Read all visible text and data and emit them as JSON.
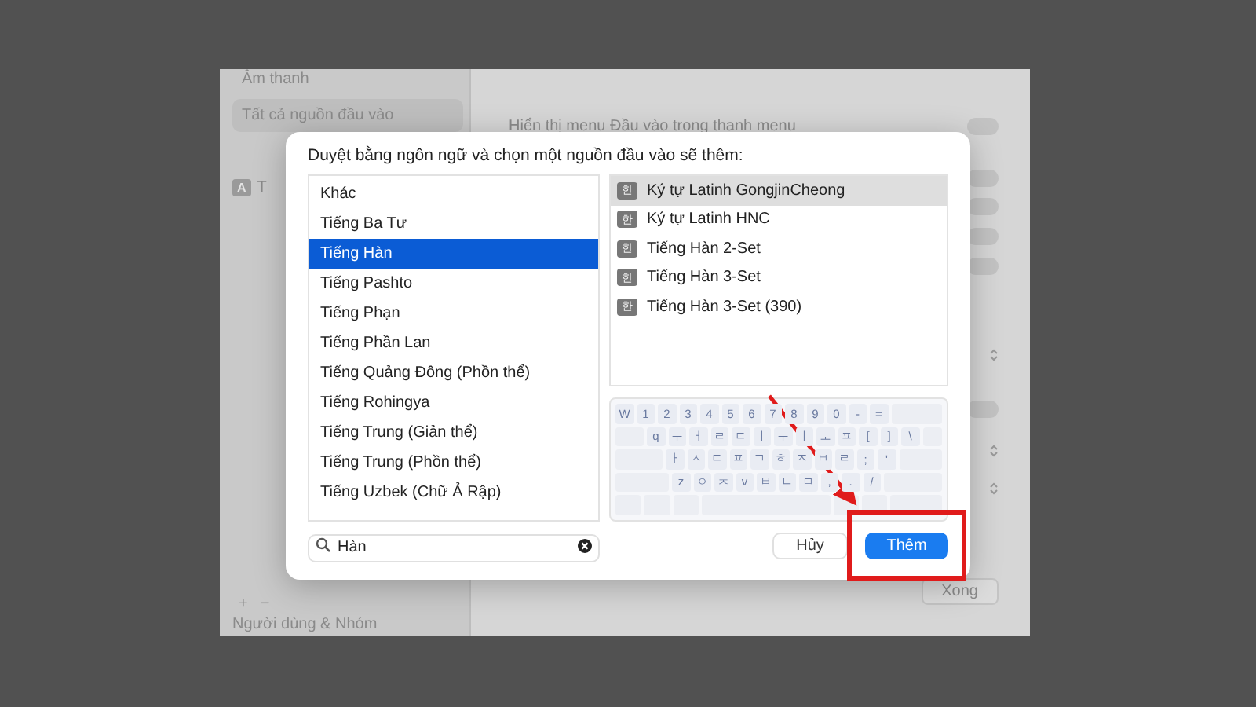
{
  "background_window": {
    "sidebar": {
      "items": [
        {
          "label": "Âm thanh",
          "selected": false
        },
        {
          "label": "Tất cả nguồn đầu vào",
          "selected": true
        }
      ],
      "input_badge": "A",
      "input_label": "T",
      "add": "+",
      "remove": "−",
      "footer_item": "Người dùng & Nhóm"
    },
    "settings": {
      "menu_label": "Hiển thị menu Đầu vào trong thanh menu",
      "controls": [
        {
          "kind": "toggle",
          "on": false
        },
        {
          "kind": "toggle",
          "on": false
        },
        {
          "kind": "toggle",
          "on": false
        },
        {
          "kind": "toggle",
          "on": false
        },
        {
          "kind": "toggle",
          "on": false
        },
        {
          "kind": "stepper"
        },
        {
          "kind": "toggle",
          "on": false
        },
        {
          "kind": "stepper"
        },
        {
          "kind": "stepper"
        }
      ]
    },
    "done_button": "Xong"
  },
  "dialog": {
    "prompt": "Duyệt bằng ngôn ngữ và chọn một nguồn đầu vào sẽ thêm:",
    "languages": [
      {
        "label": "Khác",
        "selected": false
      },
      {
        "label": "Tiếng Ba Tư",
        "selected": false
      },
      {
        "label": "Tiếng Hàn",
        "selected": true
      },
      {
        "label": "Tiếng Pashto",
        "selected": false
      },
      {
        "label": "Tiếng Phạn",
        "selected": false
      },
      {
        "label": "Tiếng Phần Lan",
        "selected": false
      },
      {
        "label": "Tiếng Quảng Đông (Phồn thể)",
        "selected": false
      },
      {
        "label": "Tiếng Rohingya",
        "selected": false
      },
      {
        "label": "Tiếng Trung (Giản thể)",
        "selected": false
      },
      {
        "label": "Tiếng Trung (Phồn thể)",
        "selected": false
      },
      {
        "label": "Tiếng Uzbek (Chữ Ả Rập)",
        "selected": false
      }
    ],
    "input_sources": [
      {
        "badge": "한",
        "label": "Ký tự Latinh GongjinCheong",
        "selected": true
      },
      {
        "badge": "한",
        "label": "Ký tự Latinh HNC",
        "selected": false
      },
      {
        "badge": "한",
        "label": "Tiếng Hàn 2-Set",
        "selected": false
      },
      {
        "badge": "한",
        "label": "Tiếng Hàn 3-Set",
        "selected": false
      },
      {
        "badge": "한",
        "label": "Tiếng Hàn 3-Set (390)",
        "selected": false
      }
    ],
    "keyboard_rows": [
      [
        "W",
        "1",
        "2",
        "3",
        "4",
        "5",
        "6",
        "7",
        "8",
        "9",
        "0",
        "-",
        "="
      ],
      [
        "q",
        "ㅜ",
        "ㅓ",
        "ㄹ",
        "ㄷ",
        "ㅣ",
        "ㅜ",
        "ㅣ",
        "ㅗ",
        "ㅍ",
        "[",
        "]",
        "\\"
      ],
      [
        "ㅏ",
        "ㅅ",
        "ㄷ",
        "ㅍ",
        "ㄱ",
        "ㅎ",
        "ㅈ",
        "ㅂ",
        "ㄹ",
        ";",
        "'"
      ],
      [
        "z",
        "ㅇ",
        "ㅊ",
        "v",
        "ㅂ",
        "ㄴ",
        "ㅁ",
        ",",
        ".",
        "/"
      ]
    ],
    "search": {
      "value": "Hàn"
    },
    "cancel_button": "Hủy",
    "add_button": "Thêm"
  }
}
